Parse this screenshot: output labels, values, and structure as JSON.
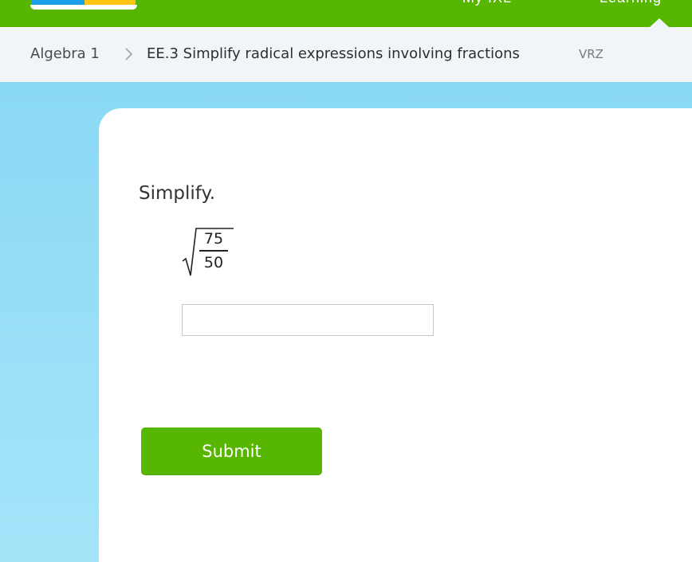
{
  "topbar": {
    "nav_links": [
      "My IXL",
      "Learning"
    ],
    "colors": {
      "brand_green": "#56b600",
      "logo_blue": "#1aa0e8",
      "logo_yellow": "#ffc40f"
    }
  },
  "breadcrumb": {
    "subject": "Algebra 1",
    "separator_icon": "chevron-right-icon",
    "skill": "EE.3 Simplify radical expressions involving fractions",
    "skill_code": "VRZ"
  },
  "question": {
    "instruction": "Simplify.",
    "expression": {
      "type": "square-root-of-fraction",
      "numerator": "75",
      "denominator": "50"
    },
    "answer": {
      "value": "",
      "placeholder": ""
    }
  },
  "submit": {
    "label": "Submit"
  },
  "colors": {
    "practice_background": "#8ad9f4",
    "submit_green": "#56b600"
  }
}
